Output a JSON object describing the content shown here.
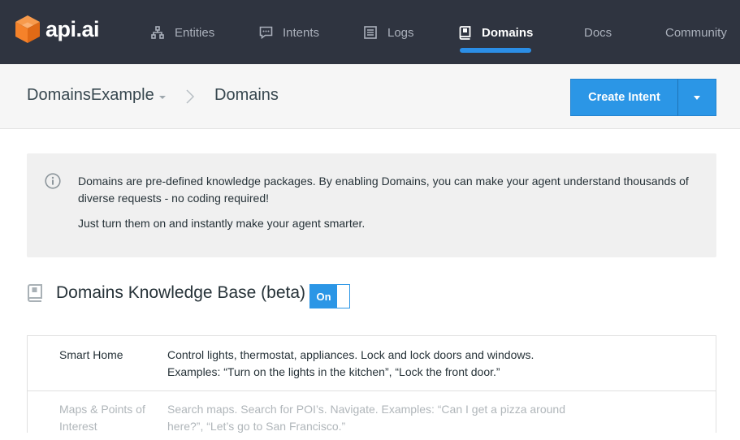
{
  "brand": {
    "name": "api.ai",
    "accent": "#f5822a"
  },
  "nav": {
    "items": [
      {
        "label": "Entities",
        "icon": "entities-icon"
      },
      {
        "label": "Intents",
        "icon": "intents-icon"
      },
      {
        "label": "Logs",
        "icon": "logs-icon"
      },
      {
        "label": "Domains",
        "icon": "book-icon",
        "active": true
      },
      {
        "label": "Docs"
      },
      {
        "label": "Community"
      }
    ]
  },
  "header": {
    "agent_name": "DomainsExample",
    "page_title": "Domains",
    "create_button": "Create Intent",
    "button_color": "#2b96e6"
  },
  "info": {
    "line1": "Domains are pre-defined knowledge packages. By enabling Domains, you can make your agent understand thousands of diverse requests - no coding required!",
    "line2": "Just turn them on and instantly make your agent smarter."
  },
  "knowledge_base": {
    "title": "Domains Knowledge Base (beta)",
    "toggle_label": "On",
    "enabled": true
  },
  "domains": [
    {
      "name": "Smart Home",
      "description_1": "Control lights, thermostat, appliances. Lock and lock doors and windows.",
      "description_2": "Examples: “Turn on the lights in the kitchen”, “Lock the front door.”"
    },
    {
      "name": "Maps & Points of Interest",
      "description": "Search maps. Search for POI’s. Navigate. Examples: “Can I get a pizza around here?”, “Let’s go to San Francisco.”"
    }
  ]
}
